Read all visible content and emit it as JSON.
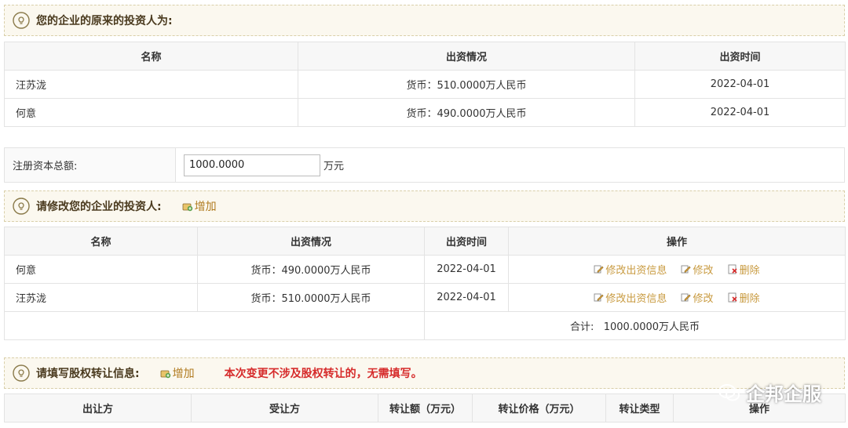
{
  "original_section": {
    "title": "您的企业的原来的投资人为:",
    "columns": [
      "名称",
      "出资情况",
      "出资时间"
    ],
    "rows": [
      {
        "name": "汪苏泷",
        "contribution": "货币：510.0000万人民币",
        "date": "2022-04-01"
      },
      {
        "name": "何意",
        "contribution": "货币：490.0000万人民币",
        "date": "2022-04-01"
      }
    ]
  },
  "registered_capital": {
    "label": "注册资本总额:",
    "value": "1000.0000",
    "unit": "万元"
  },
  "modify_section": {
    "title": "请修改您的企业的投资人:",
    "add_label": "增加",
    "columns": [
      "名称",
      "出资情况",
      "出资时间",
      "操作"
    ],
    "rows": [
      {
        "name": "何意",
        "contribution": "货币：490.0000万人民币",
        "date": "2022-04-01"
      },
      {
        "name": "汪苏泷",
        "contribution": "货币：510.0000万人民币",
        "date": "2022-04-01"
      }
    ],
    "actions": {
      "edit_info": "修改出资信息",
      "edit": "修改",
      "delete": "删除"
    },
    "total_label": "合计:",
    "total_value": "1000.0000万人民币"
  },
  "transfer_section": {
    "title": "请填写股权转让信息:",
    "add_label": "增加",
    "notice": "本次变更不涉及股权转让的，无需填写。",
    "columns": [
      "出让方",
      "受让方",
      "转让额（万元）",
      "转让价格（万元）",
      "转让类型",
      "操作"
    ]
  },
  "watermark": {
    "text": "企邦企服"
  },
  "colors": {
    "header_bg": "#fbf8ef",
    "accent": "#c89a3f",
    "notice": "#d62b2b"
  }
}
